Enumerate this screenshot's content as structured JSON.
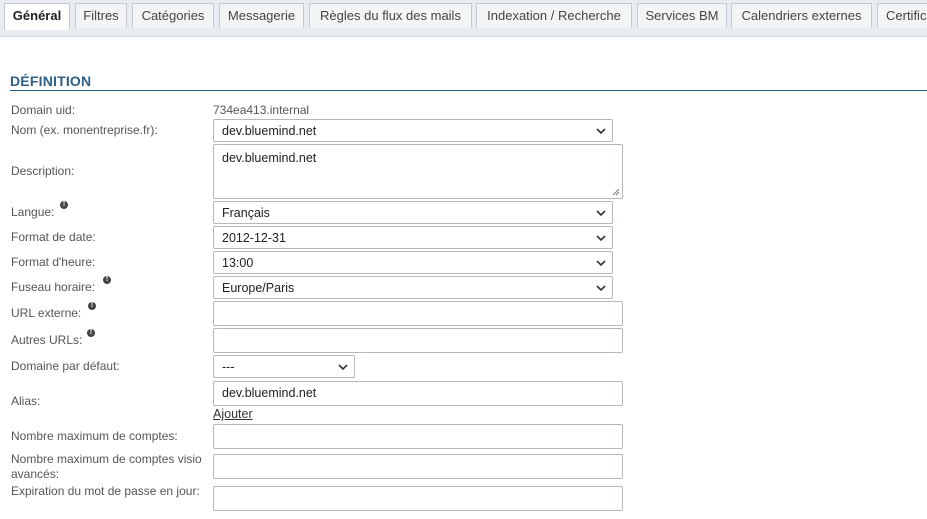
{
  "tabs": [
    {
      "label": "Général",
      "active": true
    },
    {
      "label": "Filtres",
      "active": false
    },
    {
      "label": "Catégories",
      "active": false
    },
    {
      "label": "Messagerie",
      "active": false
    },
    {
      "label": "Règles du flux des mails",
      "active": false
    },
    {
      "label": "Indexation / Recherche",
      "active": false
    },
    {
      "label": "Services BM",
      "active": false
    },
    {
      "label": "Calendriers externes",
      "active": false
    },
    {
      "label": "Certific",
      "active": false
    }
  ],
  "section": {
    "title": "DÉFINITION"
  },
  "fields": {
    "domain_uid": {
      "label": "Domain uid:",
      "value": "734ea413.internal"
    },
    "name": {
      "label": "Nom (ex. monentreprise.fr):",
      "value": "dev.bluemind.net"
    },
    "description": {
      "label": "Description:",
      "value": "dev.bluemind.net"
    },
    "language": {
      "label": "Langue:",
      "value": "Français"
    },
    "date_format": {
      "label": "Format de date:",
      "value": "2012-12-31"
    },
    "time_format": {
      "label": "Format d'heure:",
      "value": "13:00"
    },
    "timezone": {
      "label": "Fuseau horaire:",
      "value": "Europe/Paris"
    },
    "external_url": {
      "label": "URL externe:",
      "value": ""
    },
    "other_urls": {
      "label": "Autres URLs:",
      "value": ""
    },
    "default_domain": {
      "label": "Domaine par défaut:",
      "value": "---"
    },
    "alias": {
      "label": "Alias:",
      "value": "dev.bluemind.net",
      "add_label": "Ajouter"
    },
    "max_accounts": {
      "label": "Nombre maximum de comptes:",
      "value": ""
    },
    "max_visio_accounts": {
      "label": "Nombre maximum de comptes visio avancés:",
      "value": ""
    },
    "password_expiration": {
      "label": "Expiration du mot de passe en jour:",
      "value": ""
    }
  },
  "icons": {
    "info": "info-icon",
    "chevron": "chevron-down-icon",
    "resize": "resize-grip-icon"
  },
  "colors": {
    "accent": "#2e5f86",
    "tabbar_bg": "#e9edf1"
  }
}
